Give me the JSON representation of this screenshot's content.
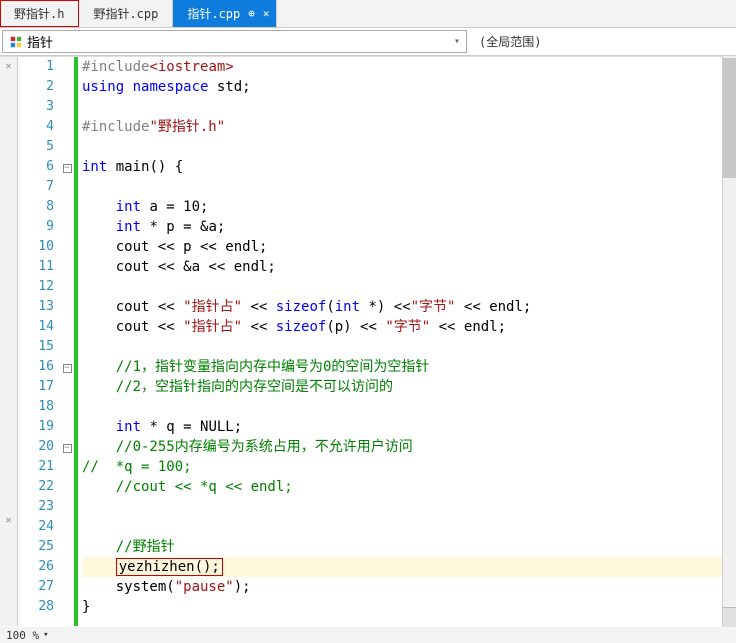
{
  "tabs": [
    {
      "label": "野指针.h",
      "active": false,
      "highlighted": true
    },
    {
      "label": "野指针.cpp",
      "active": false,
      "highlighted": false
    },
    {
      "label": "指针.cpp",
      "active": true,
      "highlighted": false
    }
  ],
  "pin_glyph": "⊕",
  "close_glyph": "✕",
  "scope": {
    "left": "指针",
    "right": "(全局范围)"
  },
  "status": {
    "zoom": "100 %"
  },
  "code_lines": [
    {
      "n": 1,
      "fold": "",
      "html": "<span class='pp'>#include</span><span class='inc'>&lt;iostream&gt;</span>"
    },
    {
      "n": 2,
      "fold": "",
      "html": "<span class='kw'>using</span> <span class='kw'>namespace</span> std;"
    },
    {
      "n": 3,
      "fold": "",
      "html": ""
    },
    {
      "n": 4,
      "fold": "",
      "html": "<span class='pp'>#include</span><span class='str'>\"野指针.h\"</span>"
    },
    {
      "n": 5,
      "fold": "",
      "html": ""
    },
    {
      "n": 6,
      "fold": "⊟",
      "html": "<span class='kw'>int</span> main() {"
    },
    {
      "n": 7,
      "fold": "",
      "html": ""
    },
    {
      "n": 8,
      "fold": "",
      "html": "    <span class='kw'>int</span> a = 10;"
    },
    {
      "n": 9,
      "fold": "",
      "html": "    <span class='kw'>int</span> * p = &amp;a;"
    },
    {
      "n": 10,
      "fold": "",
      "html": "    cout &lt;&lt; p &lt;&lt; endl;"
    },
    {
      "n": 11,
      "fold": "",
      "html": "    cout &lt;&lt; &amp;a &lt;&lt; endl;"
    },
    {
      "n": 12,
      "fold": "",
      "html": ""
    },
    {
      "n": 13,
      "fold": "",
      "html": "    cout &lt;&lt; <span class='str'>\"指针占\"</span> &lt;&lt; <span class='kw'>sizeof</span>(<span class='kw'>int</span> *) &lt;&lt;<span class='str'>\"字节\"</span> &lt;&lt; endl;"
    },
    {
      "n": 14,
      "fold": "",
      "html": "    cout &lt;&lt; <span class='str'>\"指针占\"</span> &lt;&lt; <span class='kw'>sizeof</span>(p) &lt;&lt; <span class='str'>\"字节\"</span> &lt;&lt; endl;"
    },
    {
      "n": 15,
      "fold": "",
      "html": ""
    },
    {
      "n": 16,
      "fold": "⊟",
      "html": "    <span class='cmt'>//1，指针变量指向内存中编号为0的空间为空指针</span>"
    },
    {
      "n": 17,
      "fold": "",
      "html": "    <span class='cmt'>//2，空指针指向的内存空间是不可以访问的</span>"
    },
    {
      "n": 18,
      "fold": "",
      "html": ""
    },
    {
      "n": 19,
      "fold": "",
      "html": "    <span class='kw'>int</span> * q = NULL;"
    },
    {
      "n": 20,
      "fold": "⊟",
      "html": "    <span class='cmt'>//0-255内存编号为系统占用，不允许用户访问</span>"
    },
    {
      "n": 21,
      "fold": "",
      "html": "<span class='cmt'>//  *q = 100;</span>"
    },
    {
      "n": 22,
      "fold": "",
      "html": "    <span class='cmt'>//cout &lt;&lt; *q &lt;&lt; endl;</span>"
    },
    {
      "n": 23,
      "fold": "",
      "html": ""
    },
    {
      "n": 24,
      "fold": "",
      "html": ""
    },
    {
      "n": 25,
      "fold": "",
      "html": "    <span class='cmt'>//野指针</span>"
    },
    {
      "n": 26,
      "fold": "",
      "html": "    <span class='box'>yezhizhen();</span>",
      "sel": true
    },
    {
      "n": 27,
      "fold": "",
      "html": "    system(<span class='str'>\"pause\"</span>);"
    },
    {
      "n": 28,
      "fold": "",
      "html": "}"
    }
  ]
}
